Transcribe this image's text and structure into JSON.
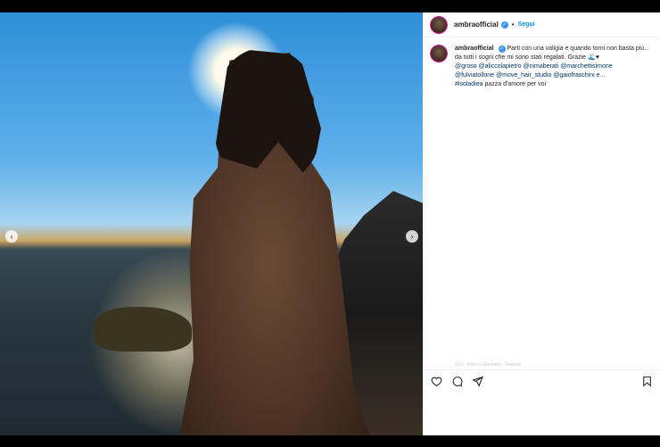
{
  "post": {
    "username": "ambraofficial",
    "separator": "•",
    "follow_label": "Segui",
    "caption_user": "ambraofficial",
    "caption_text": "Parti con una valigia e quando torni non basta più... da tutti i sogni che mi sono stati regalati. Grazie",
    "caption_tags": "@groso @aliccolapietro @nimaberati @marchettisimone @fulviatollone @move_hair_studio @gaiofraschini e...",
    "caption_tail_tag": "#isoladiea",
    "caption_tail": "pazza d'amore per voi",
    "faded_line": "15 h · Piero e Genzano · Risposti"
  },
  "media": {
    "carousel_dots": 3,
    "active_dot": 1
  },
  "icons": {
    "prev": "chevron-left-icon",
    "next": "chevron-right-icon",
    "like": "heart-icon",
    "comment": "comment-icon",
    "share": "share-icon",
    "save": "bookmark-icon"
  },
  "colors": {
    "link": "#0095f6",
    "verified": "#3897f0",
    "tag": "#00376b"
  }
}
